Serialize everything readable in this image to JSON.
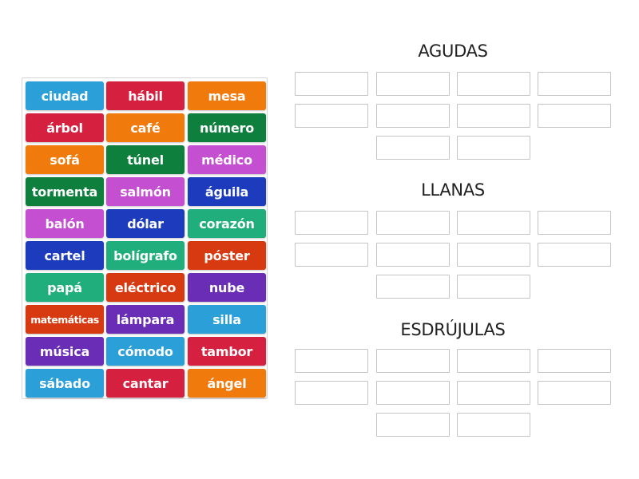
{
  "activity": {
    "type": "group-sort"
  },
  "word_bank": {
    "tiles": [
      {
        "word": "ciudad",
        "color": "#2a9fd8"
      },
      {
        "word": "hábil",
        "color": "#d5213f"
      },
      {
        "word": "mesa",
        "color": "#f07a0c"
      },
      {
        "word": "árbol",
        "color": "#d5213f"
      },
      {
        "word": "café",
        "color": "#f07a0c"
      },
      {
        "word": "número",
        "color": "#0f7f3e"
      },
      {
        "word": "sofá",
        "color": "#f07a0c"
      },
      {
        "word": "túnel",
        "color": "#0f7f3e"
      },
      {
        "word": "médico",
        "color": "#c44fd0"
      },
      {
        "word": "tormenta",
        "color": "#0f7f3e"
      },
      {
        "word": "salmón",
        "color": "#c44fd0"
      },
      {
        "word": "águila",
        "color": "#1d3bbd"
      },
      {
        "word": "balón",
        "color": "#c44fd0"
      },
      {
        "word": "dólar",
        "color": "#1d3bbd"
      },
      {
        "word": "corazón",
        "color": "#1fae7c"
      },
      {
        "word": "cartel",
        "color": "#1d3bbd"
      },
      {
        "word": "bolígrafo",
        "color": "#1fae7c"
      },
      {
        "word": "póster",
        "color": "#d73a10"
      },
      {
        "word": "papá",
        "color": "#1fae7c"
      },
      {
        "word": "eléctrico",
        "color": "#d73a10"
      },
      {
        "word": "nube",
        "color": "#6a2db5"
      },
      {
        "word": "matemáticas",
        "color": "#d73a10"
      },
      {
        "word": "lámpara",
        "color": "#6a2db5"
      },
      {
        "word": "silla",
        "color": "#2a9fd8"
      },
      {
        "word": "música",
        "color": "#6a2db5"
      },
      {
        "word": "cómodo",
        "color": "#2a9fd8"
      },
      {
        "word": "tambor",
        "color": "#d5213f"
      },
      {
        "word": "sábado",
        "color": "#2a9fd8"
      },
      {
        "word": "cantar",
        "color": "#d5213f"
      },
      {
        "word": "ángel",
        "color": "#f07a0c"
      }
    ]
  },
  "groups": [
    {
      "title": "AGUDAS",
      "slots": 10
    },
    {
      "title": "LLANAS",
      "slots": 10
    },
    {
      "title": "ESDRÚJULAS",
      "slots": 10
    }
  ]
}
